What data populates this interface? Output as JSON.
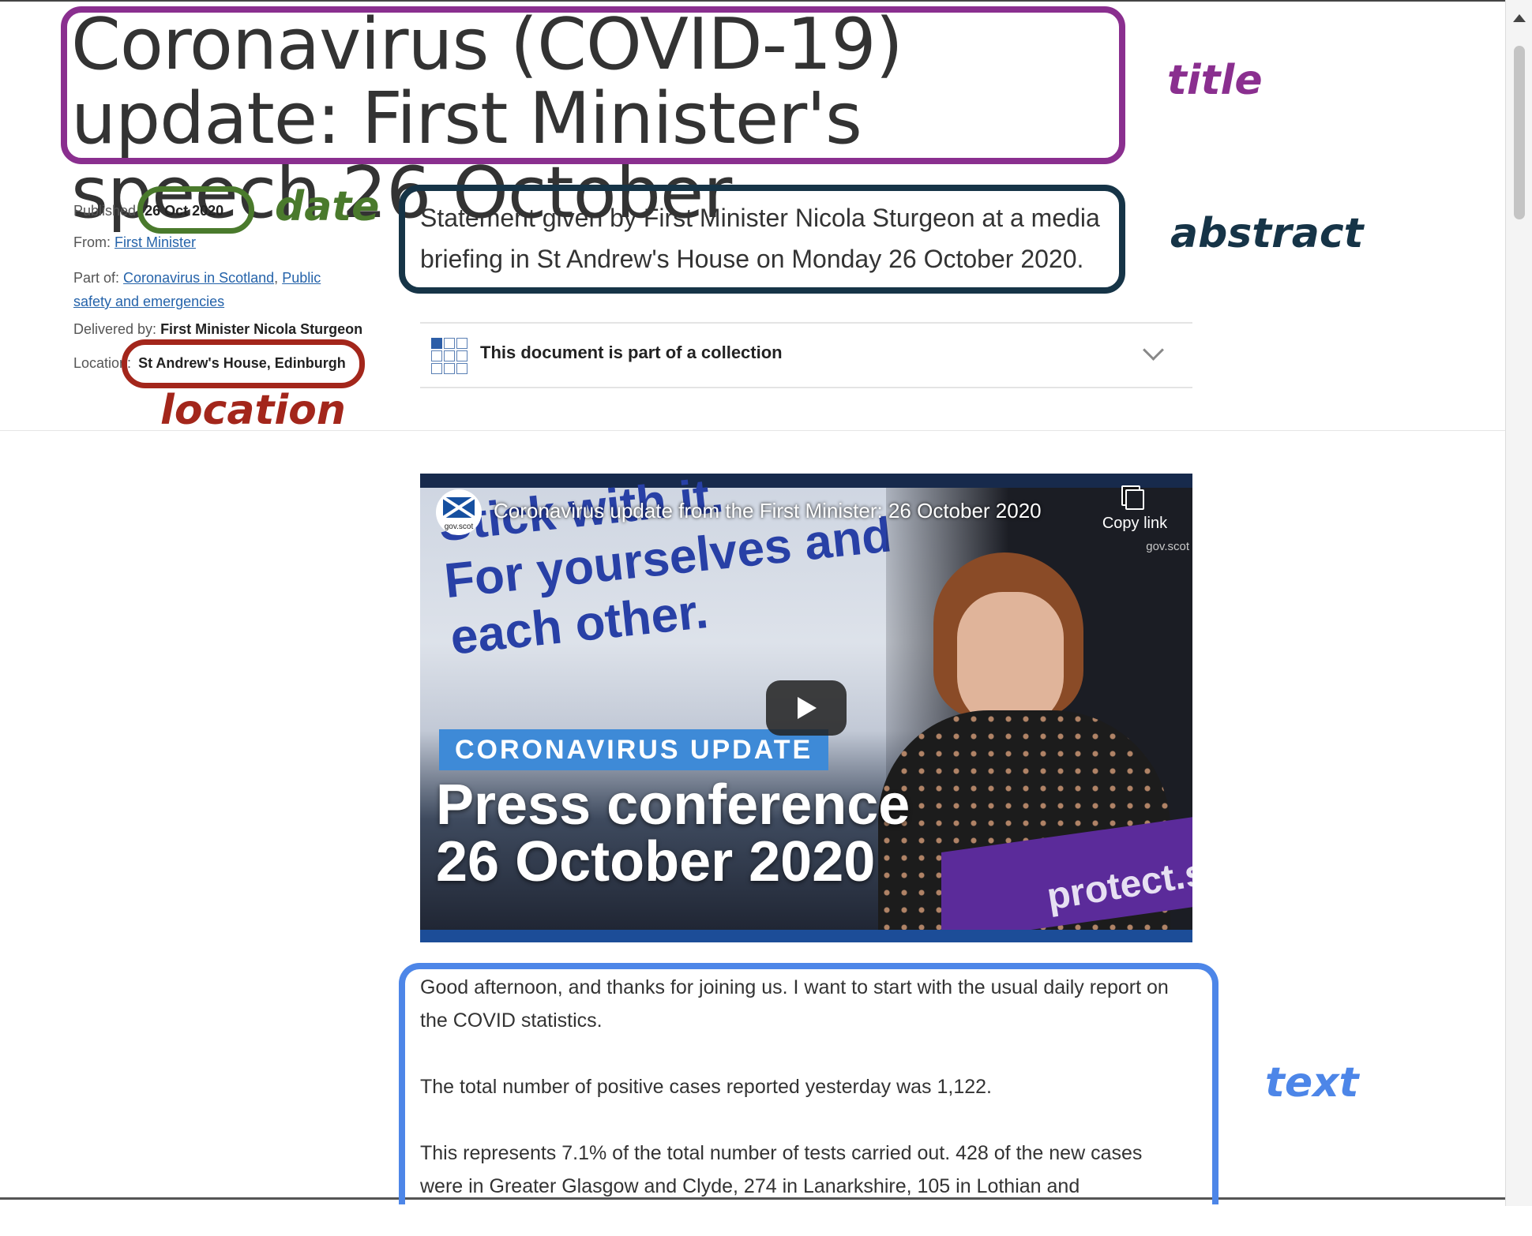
{
  "article": {
    "title": "Coronavirus (COVID-19) update: First Minister's speech 26 October",
    "meta": {
      "published_label": "Published",
      "published_date": "26 Oct 2020",
      "from_label": "From:",
      "from_link": "First Minister",
      "part_of_label": "Part of:",
      "part_of_link1": "Coronavirus in Scotland",
      "part_of_sep": ",",
      "part_of_link2": "Public safety and emergencies",
      "delivered_label": "Delivered by:",
      "delivered_value": "First Minister Nicola Sturgeon",
      "location_label": "Location:",
      "location_value": "St Andrew's House, Edinburgh"
    },
    "abstract": "Statement given by First Minister Nicola Sturgeon at a media briefing in St Andrew's House on Monday 26 October 2020.",
    "collection_label": "This document is part of a collection"
  },
  "video": {
    "title": "Coronavirus update from the First Minister: 26 October 2020",
    "copy_link": "Copy link",
    "logo_text": "gov.scot",
    "watermark": "gov.scot",
    "slogan_line1": "Stick with it.",
    "slogan_line2": "For yourselves and",
    "slogan_line3": "each other.",
    "badge": "CORONAVIRUS UPDATE",
    "headline_line1": "Press conference",
    "headline_line2": "26 October 2020",
    "lectern_text": "protect.sc"
  },
  "body": {
    "p1": "Good afternoon, and thanks for joining us. I want to start with the usual daily report on the COVID statistics.",
    "p2": "The total number of positive cases reported yesterday was 1,122.",
    "p3": "This represents 7.1% of the total number of tests carried out. 428 of the new cases were in Greater Glasgow and Clyde, 274 in Lanarkshire, 105 in Lothian and"
  },
  "annotations": {
    "title": "title",
    "date": "date",
    "abstract": "abstract",
    "location": "location",
    "text": "text",
    "colors": {
      "title": "#8a2f8f",
      "date": "#4a7a2c",
      "abstract": "#163447",
      "location": "#a3261b",
      "text": "#4d86e8"
    }
  }
}
